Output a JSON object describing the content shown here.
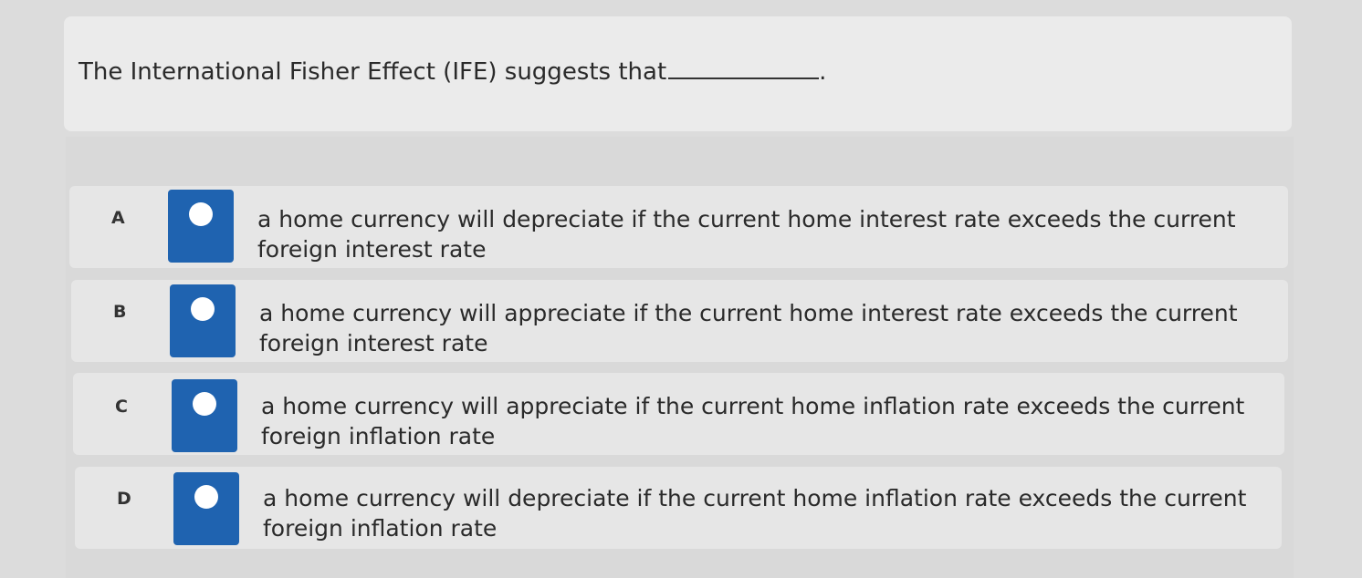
{
  "question": {
    "text": "The International Fisher Effect (IFE) suggests that",
    "end_punct": "."
  },
  "options": [
    {
      "letter": "A",
      "text": "a home currency will depreciate if the current home interest rate exceeds the current foreign interest rate"
    },
    {
      "letter": "B",
      "text": "a home currency will appreciate if the current home interest rate exceeds the current foreign interest rate"
    },
    {
      "letter": "C",
      "text": "a home currency will appreciate if the current home inflation rate exceeds the current foreign inflation rate"
    },
    {
      "letter": "D",
      "text": "a home currency will depreciate if the current home inflation rate exceeds the current foreign inflation rate"
    }
  ],
  "colors": {
    "radio_accent": "#1f63b0"
  },
  "icons": {
    "radio": "radio-button-icon"
  }
}
